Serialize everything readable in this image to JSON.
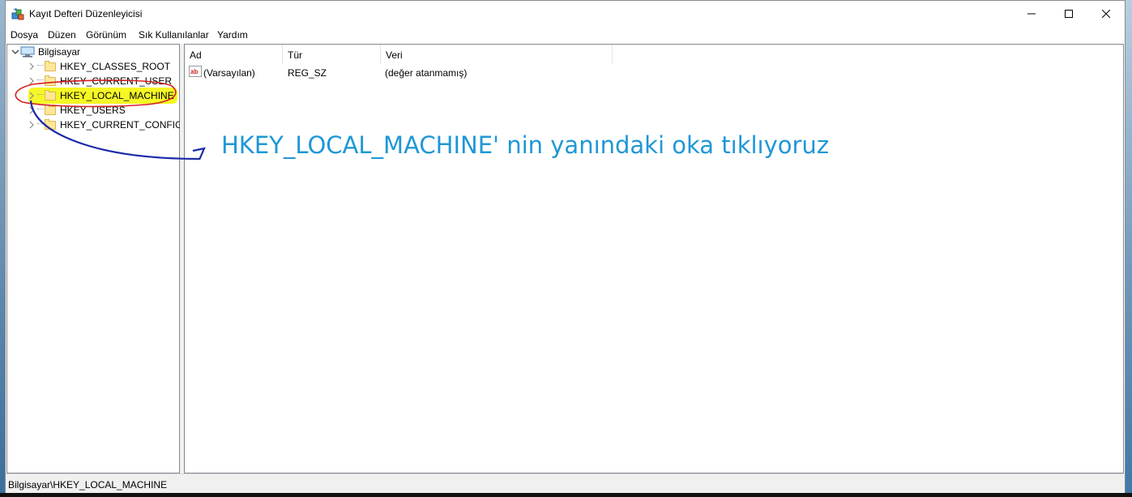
{
  "window": {
    "title": "Kayıt Defteri Düzenleyicisi"
  },
  "menu": {
    "items": [
      "Dosya",
      "Düzen",
      "Görünüm",
      "Sık Kullanılanlar",
      "Yardım"
    ]
  },
  "tree": {
    "root": "Bilgisayar",
    "children": [
      {
        "label": "HKEY_CLASSES_ROOT"
      },
      {
        "label": "HKEY_CURRENT_USER"
      },
      {
        "label": "HKEY_LOCAL_MACHINE",
        "highlighted": true
      },
      {
        "label": "HKEY_USERS"
      },
      {
        "label": "HKEY_CURRENT_CONFIG"
      }
    ]
  },
  "list": {
    "columns": [
      "Ad",
      "Tür",
      "Veri"
    ],
    "rows": [
      {
        "name": "(Varsayılan)",
        "type": "REG_SZ",
        "data": "(değer atanmamış)",
        "icon": "string-value-icon"
      }
    ]
  },
  "status": {
    "path": "Bilgisayar\\HKEY_LOCAL_MACHINE"
  },
  "annotation": {
    "text": "HKEY_LOCAL_MACHINE' nin yanındaki oka tıklıyoruz",
    "color": "#1f97d6"
  },
  "colors": {
    "highlight": "#f4f71a",
    "circle": "#d42020",
    "arrow": "#1c2aa8"
  }
}
